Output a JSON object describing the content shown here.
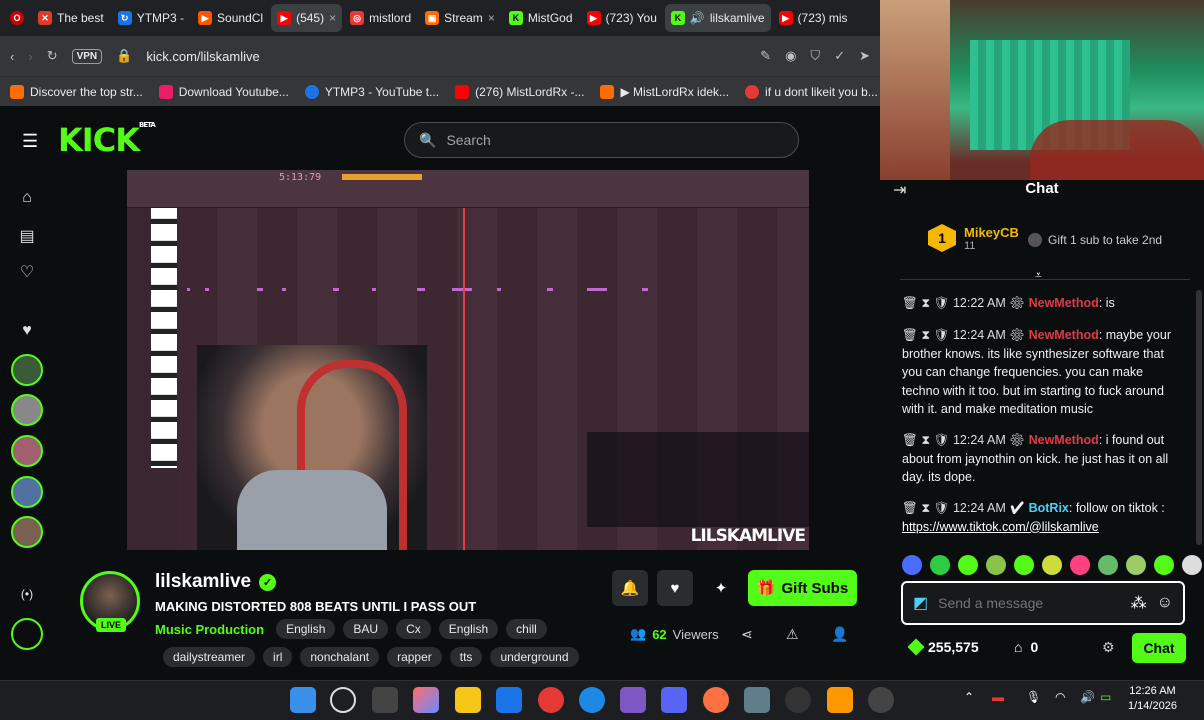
{
  "browser": {
    "tabs": [
      {
        "title": "The best",
        "color": "#e03a2a"
      },
      {
        "title": "YTMP3 -",
        "color": "#1a73e8"
      },
      {
        "title": "SoundCl",
        "color": "#ff5500"
      },
      {
        "title": "(545)",
        "color": "#ff0000"
      },
      {
        "title": "mistlord",
        "color": "#e53935"
      },
      {
        "title": "Stream",
        "color": "#ff6d00"
      },
      {
        "title": "MistGod",
        "color": "#53fc18"
      },
      {
        "title": "(723) You",
        "color": "#ff0000"
      },
      {
        "title": "lilskamlive",
        "color": "#53fc18"
      },
      {
        "title": "(723) mis",
        "color": "#ff0000"
      }
    ],
    "vpn_label": "VPN",
    "url": "kick.com/lilskamlive",
    "bookmarks": [
      {
        "label": "Discover the top str...",
        "color": "#ff6d00"
      },
      {
        "label": "Download Youtube...",
        "color": "#e91e63"
      },
      {
        "label": "YTMP3 - YouTube t...",
        "color": "#1a73e8"
      },
      {
        "label": "(276) MistLordRx -...",
        "color": "#ff0000"
      },
      {
        "label": "▶ MistLordRx idek...",
        "color": "#ff6d00"
      },
      {
        "label": "if u dont likeit you b...",
        "color": "#e53935"
      }
    ]
  },
  "kick": {
    "logo": "KICK",
    "logo_beta": "BETA",
    "search_placeholder": "Search"
  },
  "video": {
    "daw_time": "5:13:79",
    "watermark": "LILSKAMLIVE"
  },
  "stream": {
    "streamer": "lilskamlive",
    "live_label": "LIVE",
    "title": "MAKING DISTORTED 808 BEATS UNTIL I PASS OUT",
    "category": "Music Production",
    "tags_row1": [
      "English",
      "BAU",
      "Cx",
      "English",
      "chill"
    ],
    "tags_row2": [
      "dailystreamer",
      "irl",
      "nonchalant",
      "rapper",
      "tts",
      "underground"
    ],
    "gift_subs_label": "Gift Subs",
    "viewers_count": "62",
    "viewers_label": "Viewers"
  },
  "chat": {
    "header": "Chat",
    "leader": {
      "rank": "1",
      "name": "MikeyCB",
      "count": "11"
    },
    "gift_prompt": "Gift 1 sub to take 2nd",
    "messages": [
      {
        "time": "12:22 AM",
        "user": "NewMethod",
        "text": ": is"
      },
      {
        "time": "12:24 AM",
        "user": "NewMethod",
        "text": ": maybe your brother knows. its like synthesizer software that you can change frequencies. you can make techno with it too. but im starting to fuck around with it. and make meditation music"
      },
      {
        "time": "12:24 AM",
        "user": "NewMethod",
        "text": ": i found out about from jaynothin on kick. he just has it on all day. its dope."
      },
      {
        "time": "12:24 AM",
        "user": "BotRix",
        "text": ": follow on tiktok : ",
        "link": "https://www.tiktok.com/@lilskamlive"
      }
    ],
    "input_placeholder": "Send a message",
    "points": "255,575",
    "drops": "0",
    "send_label": "Chat"
  },
  "taskbar": {
    "time": "12:26 AM",
    "date": "1/14/2026"
  },
  "colors": {
    "kick_green": "#53fc18",
    "bg": "#0b0e0f",
    "username_red": "#e03a4a",
    "bot_blue": "#4ad0ff"
  }
}
